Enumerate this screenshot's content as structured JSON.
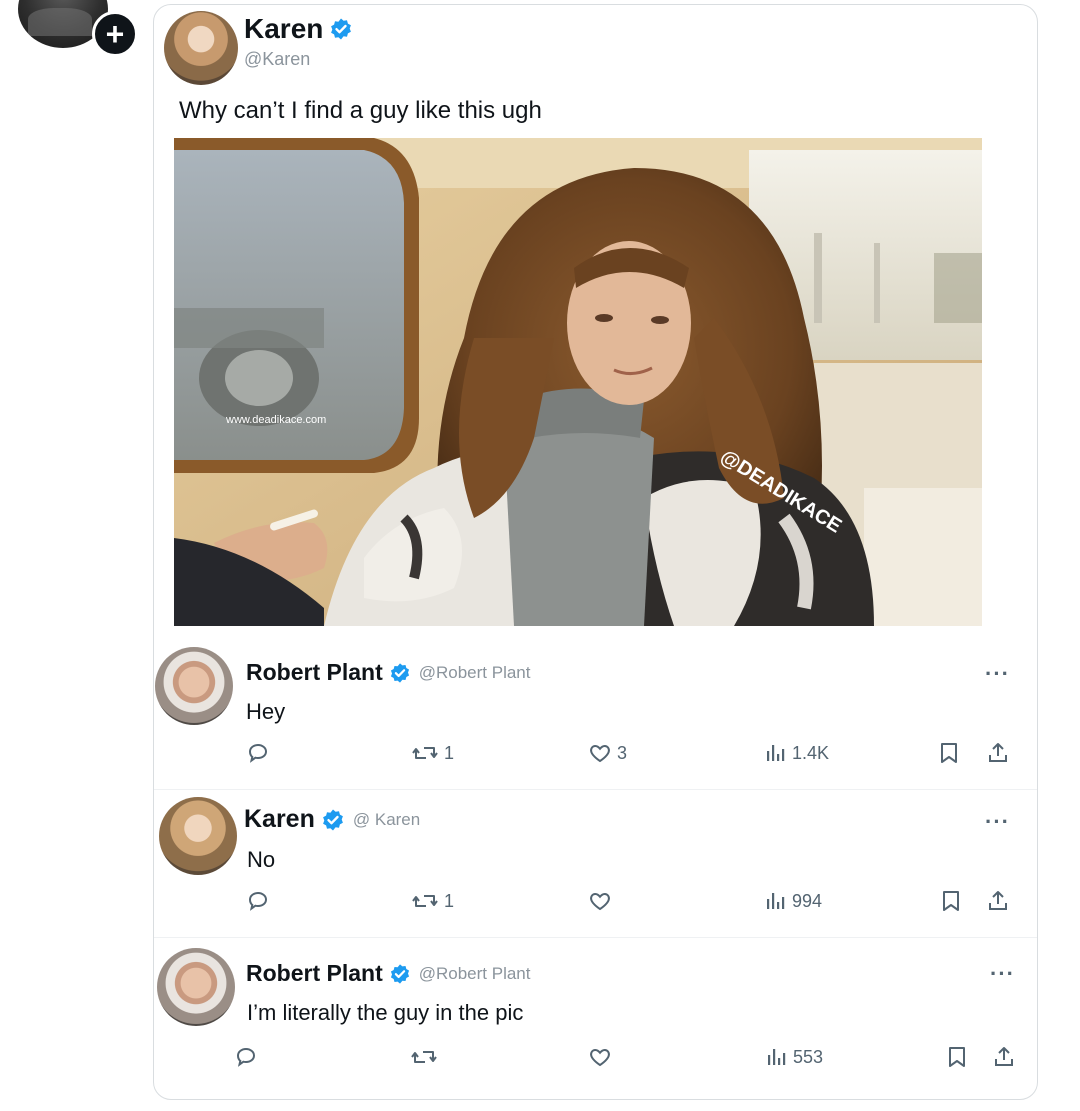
{
  "colors": {
    "verified": "#1d9bf0",
    "text": "#0f1419",
    "muted": "#536471",
    "handle": "#8b949c"
  },
  "main_tweet": {
    "display_name": "Karen",
    "handle": "@Karen",
    "text": "Why can’t I find a guy like this ugh",
    "photo": {
      "watermark_url": "www.deadikace.com",
      "watermark_tag": "@DEADIKACE"
    }
  },
  "replies": [
    {
      "display_name": "Robert Plant",
      "handle": "@Robert Plant",
      "text": "Hey",
      "reply_count": "",
      "retweets": "1",
      "likes": "3",
      "views": "1.4K"
    },
    {
      "display_name": "Karen",
      "handle": "@ Karen",
      "text": "No",
      "reply_count": "",
      "retweets": "1",
      "likes": "",
      "views": "994"
    },
    {
      "display_name": "Robert Plant",
      "handle": "@Robert Plant",
      "text": "I’m literally the guy in the pic",
      "reply_count": "",
      "retweets": "",
      "likes": "",
      "views": "553"
    }
  ]
}
